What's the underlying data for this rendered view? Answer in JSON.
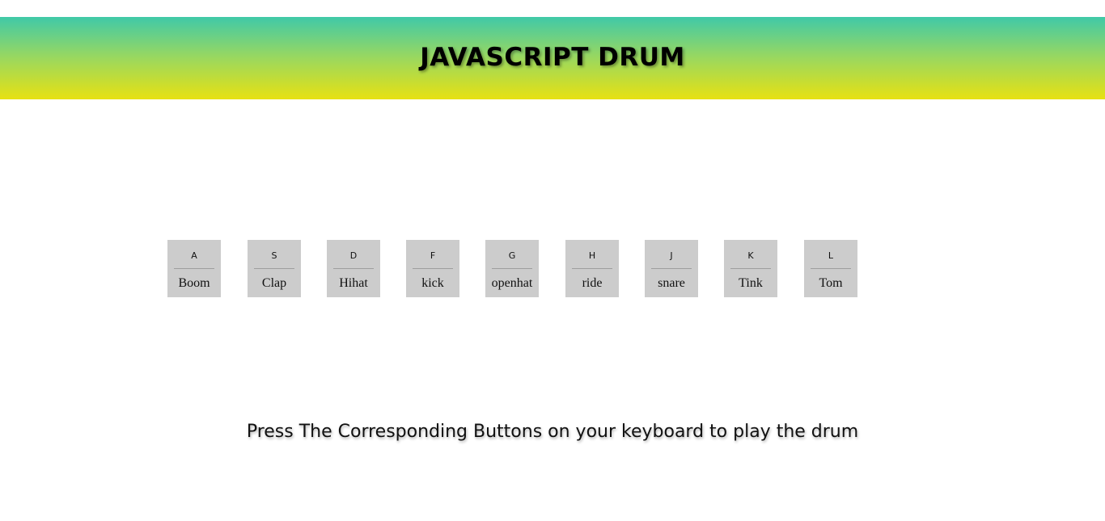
{
  "header": {
    "title": "JAVASCRIPT DRUM"
  },
  "keys": [
    {
      "key": "A",
      "sound": "Boom"
    },
    {
      "key": "S",
      "sound": "Clap"
    },
    {
      "key": "D",
      "sound": "Hihat"
    },
    {
      "key": "F",
      "sound": "kick"
    },
    {
      "key": "G",
      "sound": "openhat"
    },
    {
      "key": "H",
      "sound": "ride"
    },
    {
      "key": "J",
      "sound": "snare"
    },
    {
      "key": "K",
      "sound": "Tink"
    },
    {
      "key": "L",
      "sound": "Tom"
    }
  ],
  "instructions": "Press The Corresponding Buttons on your keyboard to play the drum",
  "colors": {
    "header_gradient_top": "#40c9a8",
    "header_gradient_bottom": "#e7e112",
    "key_background": "#cccccc"
  }
}
